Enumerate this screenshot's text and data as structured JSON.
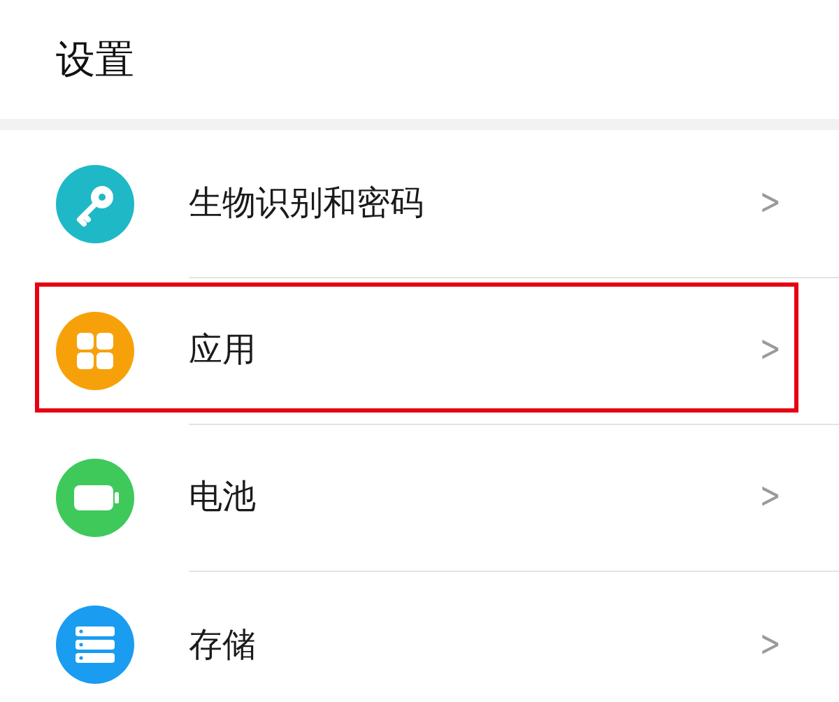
{
  "header": {
    "title": "设置"
  },
  "items": [
    {
      "kind": "key",
      "label": "生物识别和密码",
      "chevron": ">",
      "highlighted": false
    },
    {
      "kind": "apps",
      "label": "应用",
      "chevron": ">",
      "highlighted": true
    },
    {
      "kind": "battery",
      "label": "电池",
      "chevron": ">",
      "highlighted": false
    },
    {
      "kind": "storage",
      "label": "存储",
      "chevron": ">",
      "highlighted": false
    }
  ]
}
